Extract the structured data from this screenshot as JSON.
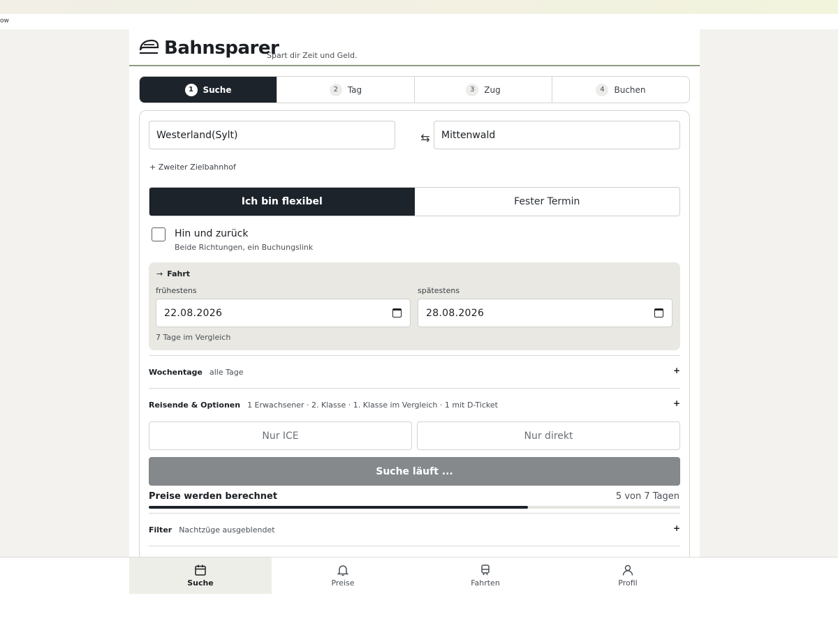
{
  "browser": {
    "strip_text": "ow"
  },
  "app": {
    "brand": "Bahnsparer",
    "tagline": "Spart dir Zeit und Geld."
  },
  "steps": [
    {
      "num": "1",
      "label": "Suche",
      "active": true
    },
    {
      "num": "2",
      "label": "Tag",
      "active": false
    },
    {
      "num": "3",
      "label": "Zug",
      "active": false
    },
    {
      "num": "4",
      "label": "Buchen",
      "active": false
    }
  ],
  "search": {
    "from": "Westerland(Sylt)",
    "to": "Mittenwald",
    "add_destination": "+ Zweiter Zielbahnhof",
    "mode_flexible": "Ich bin flexibel",
    "mode_fixed": "Fester Termin",
    "roundtrip_label": "Hin und zurück",
    "roundtrip_sub": "Beide Richtungen, ein Buchungslink",
    "roundtrip_checked": false
  },
  "dates": {
    "section_label": "Fahrt",
    "earliest_label": "frühestens",
    "earliest_value": "22.08.2026",
    "latest_label": "spätestens",
    "latest_value": "28.08.2026",
    "note": "7 Tage im Vergleich"
  },
  "rows": {
    "weekdays_key": "Wochentage",
    "weekdays_value": "alle Tage",
    "travelers_key": "Reisende & Optionen",
    "travelers_value": "1 Erwachsener · 2. Klasse · 1. Klasse im Vergleich · 1 mit D-Ticket",
    "filter_key": "Filter",
    "filter_value": "Nachtzüge ausgeblendet",
    "expand_symbol": "+"
  },
  "options": {
    "only_ice": "Nur ICE",
    "only_direct": "Nur direkt"
  },
  "progress": {
    "button_label": "Suche läuft ...",
    "title": "Preise werden berechnet",
    "count_text": "5 von 7 Tagen",
    "fraction": 0.714
  },
  "nav": [
    {
      "label": "Suche",
      "icon": "calendar-icon",
      "active": true
    },
    {
      "label": "Preise",
      "icon": "bell-icon",
      "active": false
    },
    {
      "label": "Fahrten",
      "icon": "train-icon",
      "active": false
    },
    {
      "label": "Profil",
      "icon": "user-icon",
      "active": false
    }
  ],
  "colors": {
    "accent_dark": "#1c232b",
    "header_rule": "#8d9c80",
    "search_button_disabled": "#85898c",
    "date_panel": "#e9e8e3"
  }
}
